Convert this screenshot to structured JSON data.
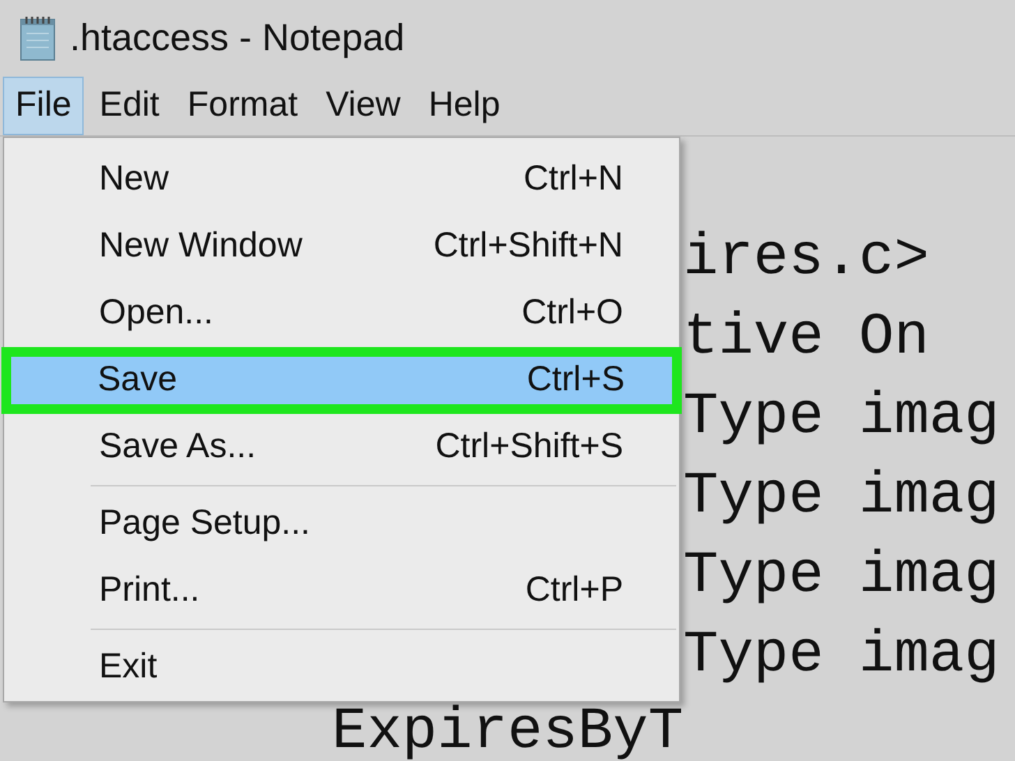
{
  "window": {
    "title": ".htaccess - Notepad"
  },
  "menubar": [
    {
      "label": "File",
      "selected": true
    },
    {
      "label": "Edit",
      "selected": false
    },
    {
      "label": "Format",
      "selected": false
    },
    {
      "label": "View",
      "selected": false
    },
    {
      "label": "Help",
      "selected": false
    }
  ],
  "file_menu": [
    {
      "kind": "item",
      "label": "New",
      "shortcut": "Ctrl+N",
      "selected": false,
      "annotated": false
    },
    {
      "kind": "item",
      "label": "New Window",
      "shortcut": "Ctrl+Shift+N",
      "selected": false,
      "annotated": false
    },
    {
      "kind": "item",
      "label": "Open...",
      "shortcut": "Ctrl+O",
      "selected": false,
      "annotated": false
    },
    {
      "kind": "item",
      "label": "Save",
      "shortcut": "Ctrl+S",
      "selected": true,
      "annotated": true
    },
    {
      "kind": "item",
      "label": "Save As...",
      "shortcut": "Ctrl+Shift+S",
      "selected": false,
      "annotated": false
    },
    {
      "kind": "separator"
    },
    {
      "kind": "item",
      "label": "Page Setup...",
      "selected": false,
      "annotated": false
    },
    {
      "kind": "item",
      "label": "Print...",
      "shortcut": "Ctrl+P",
      "selected": false,
      "annotated": false
    },
    {
      "kind": "separator"
    },
    {
      "kind": "item",
      "label": "Exit",
      "selected": false,
      "annotated": false
    }
  ],
  "editor": {
    "lines": [
      {
        "text": "ires.c>"
      },
      {
        "text": "tive On"
      },
      {
        "text": "Type imag"
      },
      {
        "text": "Type imag"
      },
      {
        "text": "Type imag"
      },
      {
        "text": "Type imag"
      },
      {
        "text": "ExpiresByT"
      }
    ]
  }
}
